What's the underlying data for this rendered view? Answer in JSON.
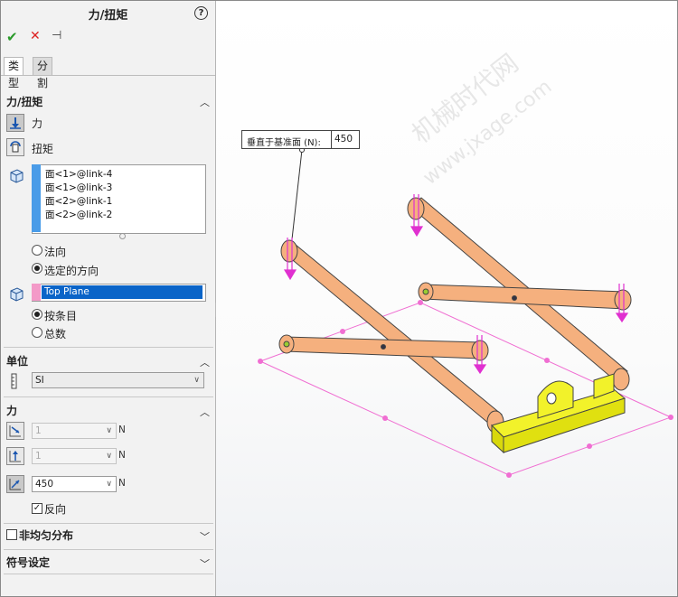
{
  "panel": {
    "title": "力/扭矩",
    "help_glyph": "?",
    "ok_glyph": "✔",
    "cancel_glyph": "✕",
    "pin_glyph": "⊣",
    "tabs": [
      {
        "label": "类型"
      },
      {
        "label": "分割"
      }
    ]
  },
  "force_torque": {
    "header": "力/扭矩",
    "force_label": "力",
    "torque_label": "扭矩",
    "faces": [
      "面<1>@link-4",
      "面<1>@link-3",
      "面<2>@link-1",
      "面<2>@link-2"
    ],
    "direction_options": [
      {
        "label": "法向",
        "selected": false
      },
      {
        "label": "选定的方向",
        "selected": true
      }
    ],
    "plane_value": "Top Plane",
    "per_options": [
      {
        "label": "按条目",
        "selected": true
      },
      {
        "label": "总数",
        "selected": false
      }
    ]
  },
  "units": {
    "header": "单位",
    "system": "SI"
  },
  "force": {
    "header": "力",
    "rows": [
      {
        "value": "1",
        "unit": "N",
        "enabled": false
      },
      {
        "value": "1",
        "unit": "N",
        "enabled": false
      },
      {
        "value": "450",
        "unit": "N",
        "enabled": true
      }
    ],
    "reverse_label": "反向",
    "reverse_checked": true
  },
  "nonuniform": {
    "header": "非均匀分布"
  },
  "symbol": {
    "header": "符号设定"
  },
  "viewport": {
    "callout_label": "垂直于基准面 (N):",
    "callout_value": "450",
    "watermark_1": "机械时代网",
    "watermark_2": "www.jxage.com",
    "colors": {
      "links": "#f5b07e",
      "base": "#f2f22a",
      "plane": "#f06ed2",
      "arrows": "#e030d0"
    }
  }
}
